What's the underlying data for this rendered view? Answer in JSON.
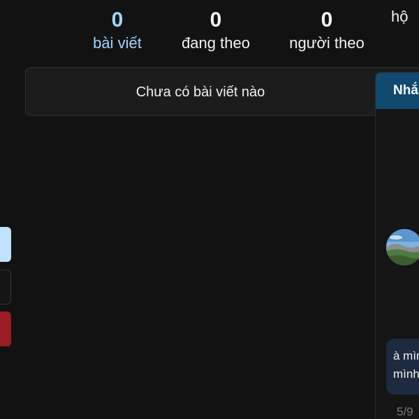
{
  "stats": {
    "posts": {
      "count": "0",
      "label": "bài viết"
    },
    "following": {
      "count": "0",
      "label": "đang theo"
    },
    "followers": {
      "count": "0",
      "label": "người theo"
    },
    "groups": {
      "count": "",
      "label": "hộ"
    }
  },
  "posts_section": {
    "empty_message": "Chưa có bài viết nào"
  },
  "chat": {
    "header": "Nhắ",
    "message_text": "à mìn\nmình",
    "counter": "5/9"
  },
  "colors": {
    "background": "#121212",
    "active_stat": "#9fd4ff",
    "chat_header": "#114a6e",
    "bubble": "#1d2a3f",
    "danger_button": "#9a1c22",
    "light_button": "#bfe3ff"
  }
}
